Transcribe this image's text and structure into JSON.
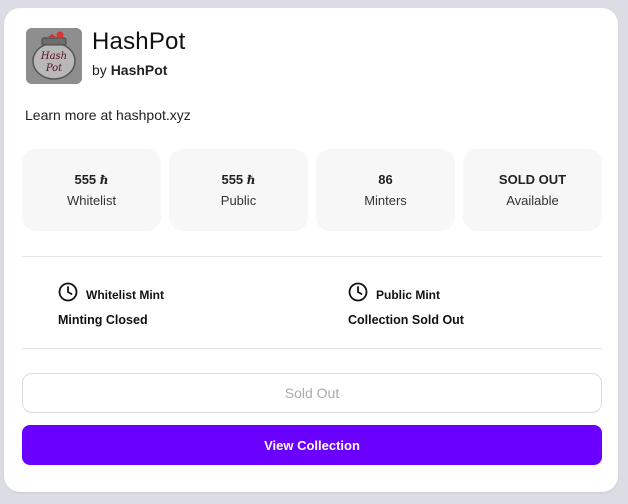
{
  "collection": {
    "name": "HashPot",
    "by_prefix": "by",
    "creator": "HashPot",
    "learn_more": "Learn more at hashpot.xyz",
    "logo_text": "Hash Pot"
  },
  "stats": [
    {
      "value": "555",
      "unit": "ℏ",
      "label": "Whitelist"
    },
    {
      "value": "555",
      "unit": "ℏ",
      "label": "Public"
    },
    {
      "value": "86",
      "unit": "",
      "label": "Minters"
    },
    {
      "value": "SOLD OUT",
      "unit": "",
      "label": "Available"
    }
  ],
  "phases": [
    {
      "title": "Whitelist Mint",
      "status": "Minting Closed",
      "icon": "clock-icon"
    },
    {
      "title": "Public Mint",
      "status": "Collection Sold Out",
      "icon": "clock-icon"
    }
  ],
  "buttons": {
    "sold_out": "Sold Out",
    "view_collection": "View Collection"
  },
  "colors": {
    "accent": "#6a00ff",
    "stat_bg": "#f7f7f8"
  }
}
